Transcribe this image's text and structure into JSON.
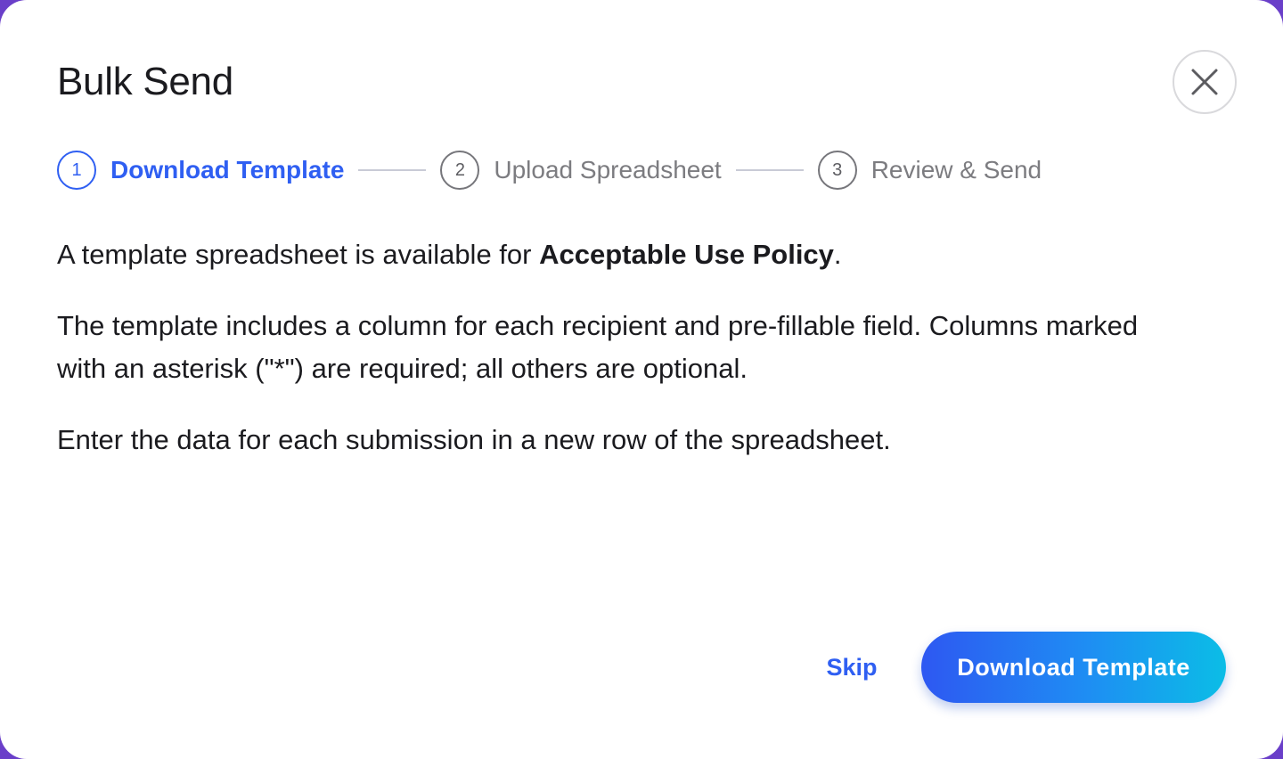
{
  "dialog": {
    "title": "Bulk Send",
    "close_icon": "close-icon"
  },
  "stepper": {
    "steps": [
      {
        "number": "1",
        "label": "Download Template",
        "state": "active"
      },
      {
        "number": "2",
        "label": "Upload Spreadsheet",
        "state": "inactive"
      },
      {
        "number": "3",
        "label": "Review & Send",
        "state": "inactive"
      }
    ]
  },
  "content": {
    "intro_prefix": "A template spreadsheet is available for ",
    "document_name": "Acceptable Use Policy",
    "intro_suffix": ".",
    "paragraph_columns": "The template includes a column for each recipient and pre-fillable field. Columns marked with an asterisk (\"*\") are required; all others are optional.",
    "paragraph_rows": "Enter the data for each submission in a new row of the spreadsheet."
  },
  "footer": {
    "skip_label": "Skip",
    "primary_label": "Download Template"
  },
  "colors": {
    "accent": "#2f5ff2",
    "gradient_end": "#0bbde6",
    "inactive_text": "#7c7c80",
    "backdrop": "#6a3fc9"
  }
}
